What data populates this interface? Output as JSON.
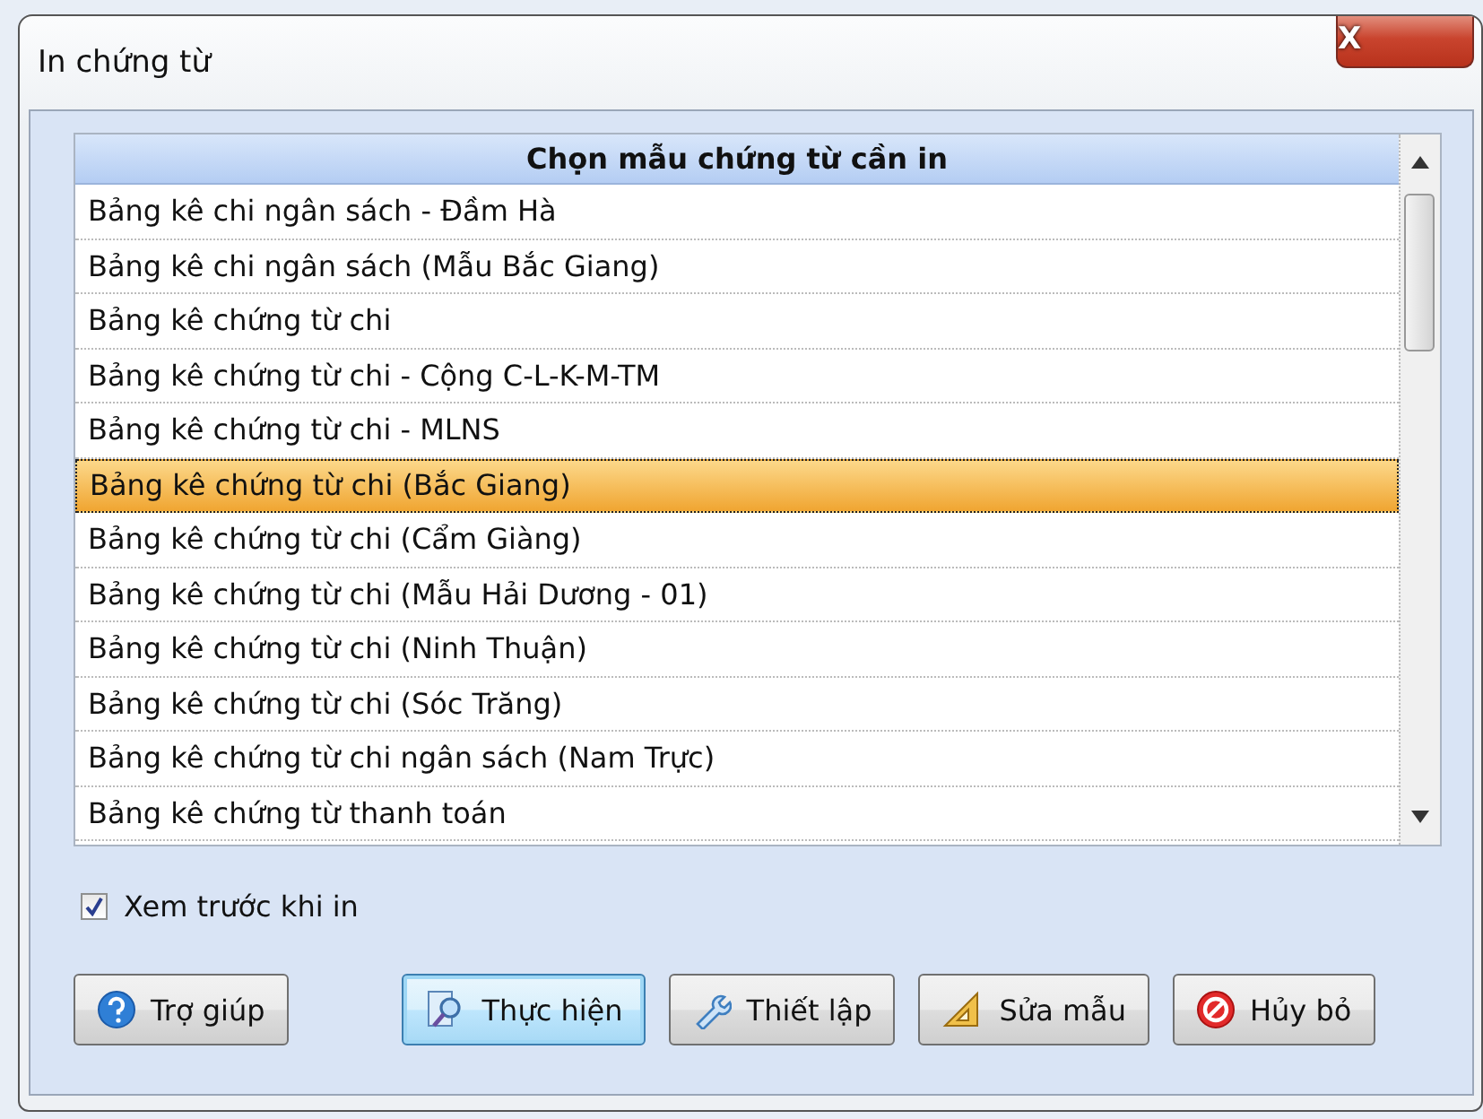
{
  "window": {
    "title": "In chứng từ",
    "close_label": "X"
  },
  "list": {
    "header": "Chọn mẫu chứng từ cần in",
    "items": [
      {
        "label": "Bảng kê chi ngân sách - Đầm Hà",
        "selected": false
      },
      {
        "label": "Bảng kê chi ngân sách (Mẫu Bắc Giang)",
        "selected": false
      },
      {
        "label": "Bảng kê chứng từ chi",
        "selected": false
      },
      {
        "label": "Bảng kê chứng từ chi - Cộng C-L-K-M-TM",
        "selected": false
      },
      {
        "label": "Bảng kê chứng từ chi - MLNS",
        "selected": false
      },
      {
        "label": "Bảng kê chứng từ chi (Bắc Giang)",
        "selected": true
      },
      {
        "label": "Bảng kê chứng từ chi (Cẩm Giàng)",
        "selected": false
      },
      {
        "label": "Bảng kê chứng từ chi (Mẫu Hải Dương - 01)",
        "selected": false
      },
      {
        "label": "Bảng kê chứng từ chi (Ninh Thuận)",
        "selected": false
      },
      {
        "label": "Bảng kê chứng từ chi (Sóc Trăng)",
        "selected": false
      },
      {
        "label": "Bảng kê chứng từ chi ngân sách (Nam Trực)",
        "selected": false
      },
      {
        "label": "Bảng kê chứng từ thanh toán",
        "selected": false
      }
    ]
  },
  "preview": {
    "label": "Xem trước khi in",
    "checked": true
  },
  "buttons": [
    {
      "kind": "help",
      "label": "Trợ giúp",
      "focused": false
    },
    {
      "kind": "run",
      "label": "Thực hiện",
      "focused": true
    },
    {
      "kind": "settings",
      "label": "Thiết lập",
      "focused": false
    },
    {
      "kind": "edit",
      "label": "Sửa mẫu",
      "focused": false
    },
    {
      "kind": "cancel",
      "label": "Hủy bỏ",
      "focused": false
    }
  ]
}
